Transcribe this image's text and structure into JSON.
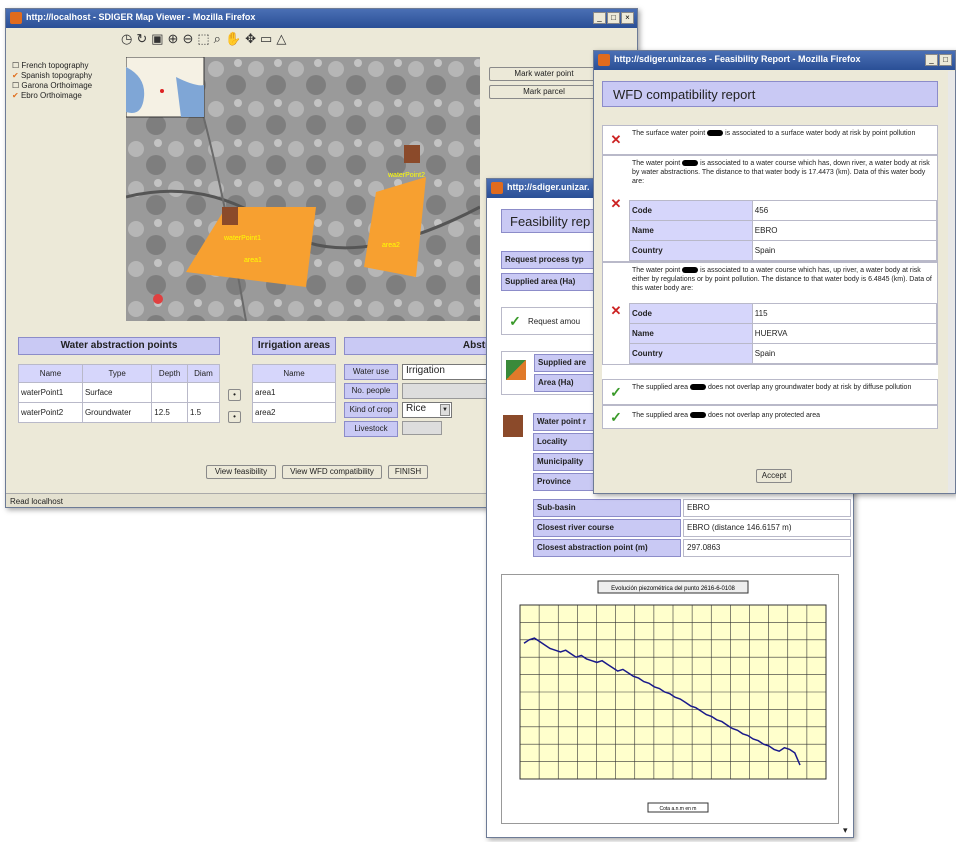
{
  "map_window": {
    "title": "http://localhost - SDIGER Map Viewer - Mozilla Firefox",
    "layers": [
      {
        "label": "French topography",
        "checked": false
      },
      {
        "label": "Spanish topography",
        "checked": true
      },
      {
        "label": "Garona Orthoimage",
        "checked": false
      },
      {
        "label": "Ebro Orthoimage",
        "checked": true
      }
    ],
    "mark_water_point": "Mark water point",
    "mark_parcel": "Mark parcel",
    "map_labels": {
      "water_point_1": "waterPoint1",
      "water_point_2": "waterPoint2",
      "area_1": "area1",
      "area_2": "area2"
    },
    "water_points": {
      "title": "Water abstraction points",
      "headers": [
        "Name",
        "Type",
        "Depth",
        "Diam"
      ],
      "rows": [
        [
          "waterPoint1",
          "Surface",
          "",
          ""
        ],
        [
          "waterPoint2",
          "Groundwater",
          "12.5",
          "1.5"
        ]
      ]
    },
    "irrigation": {
      "title": "Irrigation areas",
      "header": "Name",
      "rows": [
        "area1",
        "area2"
      ]
    },
    "abstraction": {
      "title": "Abstraction r",
      "water_use_label": "Water use",
      "water_use_value": "Irrigation",
      "no_people_label": "No. people",
      "crop_label": "Kind of crop",
      "crop_value": "Rice",
      "livestock_label": "Livestock"
    },
    "view_feasibility": "View feasibility",
    "view_wfd": "View WFD compatibility",
    "finish": "FINISH",
    "status": "Read localhost"
  },
  "feasibility_window": {
    "title": "http://sdiger.unizar.",
    "heading": "Feasibility rep",
    "request_process_label": "Request process typ",
    "supplied_area_label": "Supplied area (Ha)",
    "request_amount_label": "Request amou",
    "supplied_area2_label": "Supplied are",
    "area_label": "Area (Ha)",
    "water_point_label": "Water point r",
    "locality_label": "Locality",
    "municipality_label": "Municipality",
    "province_label": "Province",
    "subbasin_label": "Sub-basin",
    "subbasin_value": "EBRO",
    "closest_river_label": "Closest river course",
    "closest_river_value": "EBRO (distance 146.6157 m)",
    "closest_point_label": "Closest abstraction point (m)",
    "closest_point_value": "297.0863",
    "chart_title": "Evolución piezométrica del punto 2616-6-0108",
    "chart_legend": "Cota a.n.m en m",
    "chart_data": {
      "type": "line",
      "title": "Evolución piezométrica del punto 2616-6-0108",
      "series": [
        {
          "name": "Cota a.n.m en m",
          "values": [
            78,
            80,
            81,
            79,
            77,
            75,
            74,
            73,
            74,
            72,
            70,
            71,
            69,
            68,
            67,
            68,
            66,
            64,
            62,
            63,
            61,
            59,
            58,
            56,
            55,
            53,
            52,
            50,
            49,
            47,
            46,
            44,
            42,
            41,
            39,
            37,
            36,
            34,
            33,
            31,
            29,
            28,
            26,
            25,
            23,
            22,
            20,
            19,
            17,
            16,
            18,
            17,
            15,
            8
          ]
        }
      ],
      "grid": true
    }
  },
  "wfd_window": {
    "title": "http://sdiger.unizar.es - Feasibility Report - Mozilla Firefox",
    "heading": "WFD compatibility report",
    "item1_text_a": "The surface water point",
    "item1_text_b": "is associated to a surface water body at risk by point pollution",
    "item2_text_a": "The water point",
    "item2_text_b": "is associated to a water course which has, down river, a water body at risk by water abstractions. The distance to that water body is 17.4473 (km). Data of this water body are:",
    "item2_rows": [
      [
        "Code",
        "456"
      ],
      [
        "Name",
        "EBRO"
      ],
      [
        "Country",
        "Spain"
      ]
    ],
    "item3_text_a": "The water point",
    "item3_text_b": "is associated to a water course which has, up river, a water body at risk either by regulations or by point pollution. The distance to that water body is 6.4845 (km). Data of this water body are:",
    "item3_rows": [
      [
        "Code",
        "115"
      ],
      [
        "Name",
        "HUERVA"
      ],
      [
        "Country",
        "Spain"
      ]
    ],
    "item4_text_a": "The supplied area",
    "item4_text_b": "does not overlap any groundwater body at risk by diffuse pollution",
    "item5_text_a": "The supplied area",
    "item5_text_b": "does not overlap any protected area",
    "accept": "Accept"
  }
}
